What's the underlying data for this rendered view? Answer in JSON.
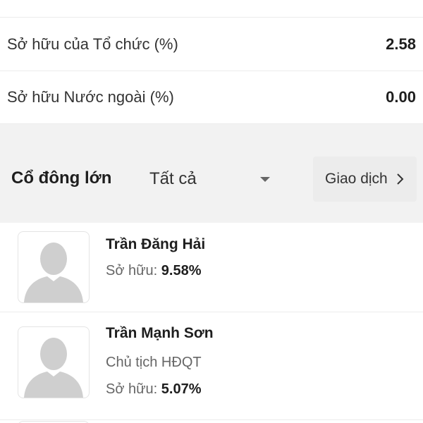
{
  "ownership_stats": [
    {
      "label": "Sở hữu của Tổ chức (%)",
      "value": "2.58"
    },
    {
      "label": "Sở hữu Nước ngoài (%)",
      "value": "0.00"
    }
  ],
  "major_shareholders": {
    "title": "Cổ đông lớn",
    "filter": {
      "selected": "Tất cả"
    },
    "trade_label": "Giao dịch",
    "own_label": "Sở hữu:",
    "items": [
      {
        "name": "Trần Đăng Hải",
        "role": "",
        "ownership": "9.58%"
      },
      {
        "name": "Trần Mạnh Sơn",
        "role": "Chủ tịch HĐQT",
        "ownership": "5.07%"
      }
    ]
  },
  "icons": {
    "avatar": "person-placeholder-icon",
    "dropdown": "caret-down-icon",
    "trade_arrow": "chevron-right-icon"
  },
  "colors": {
    "section_bg": "#f2f2f2",
    "button_bg": "#ececec",
    "text_primary": "#1e1e1e",
    "text_secondary": "#666666",
    "avatar_fill": "#cfcfcf"
  }
}
